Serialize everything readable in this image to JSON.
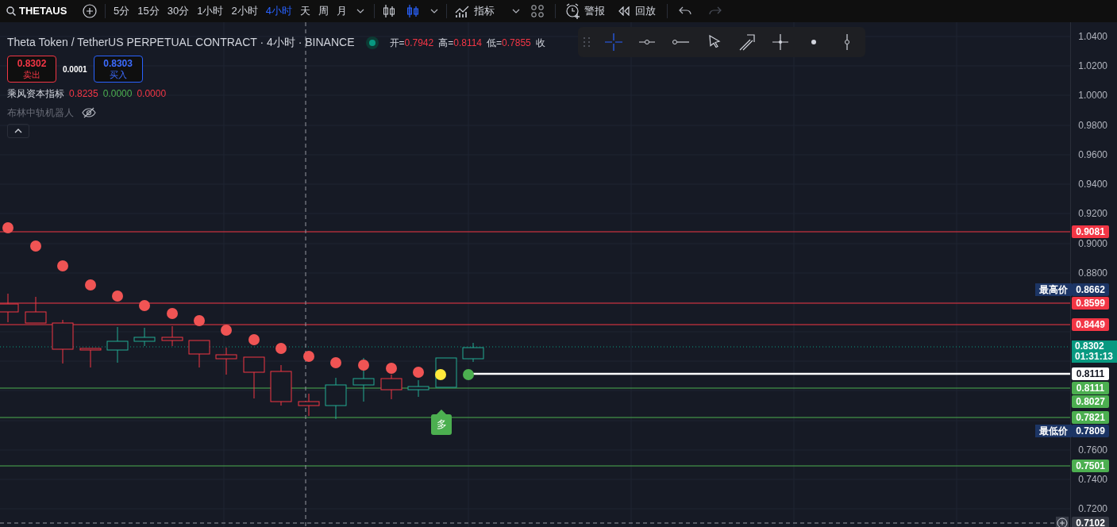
{
  "toolbar": {
    "symbol": "THETAUS",
    "intervals": [
      {
        "label": "5分",
        "selected": false
      },
      {
        "label": "15分",
        "selected": false
      },
      {
        "label": "30分",
        "selected": false
      },
      {
        "label": "1小时",
        "selected": false
      },
      {
        "label": "2小时",
        "selected": false
      },
      {
        "label": "4小时",
        "selected": true
      },
      {
        "label": "天",
        "selected": false
      },
      {
        "label": "周",
        "selected": false
      },
      {
        "label": "月",
        "selected": false
      }
    ],
    "chart_styles": [
      {
        "kind": "candles",
        "selected": false
      },
      {
        "kind": "candles",
        "selected": true
      }
    ],
    "indicators_label": "指标",
    "alert_label": "警报",
    "replay_label": "回放",
    "undo": {
      "disabled": false
    },
    "redo": {
      "disabled": true
    }
  },
  "legend": {
    "title": "Theta Token / TetherUS PERPETUAL CONTRACT · 4小时 · BINANCE",
    "ohlc": [
      {
        "label": "开=",
        "value": "0.7942"
      },
      {
        "label": "高=",
        "value": "0.8114"
      },
      {
        "label": "低=",
        "value": "0.7855"
      },
      {
        "label": "收"
      }
    ]
  },
  "trade": {
    "sell": {
      "price": "0.8302",
      "label": "卖出"
    },
    "spread": "0.0001",
    "buy": {
      "price": "0.8303",
      "label": "买入"
    }
  },
  "indicators": [
    {
      "name": "乘风资本指标",
      "hidden": false,
      "values": [
        {
          "text": "0.8235",
          "color": "#f23645"
        },
        {
          "text": "0.0000",
          "color": "#4caf50"
        },
        {
          "text": "0.0000",
          "color": "#f23645"
        }
      ]
    },
    {
      "name": "布林中轨机器人",
      "hidden": true
    }
  ],
  "drawing_tools": [
    {
      "kind": "crosshair",
      "selected": true
    },
    {
      "kind": "dot-line",
      "selected": false
    },
    {
      "kind": "ray",
      "selected": false
    },
    {
      "kind": "cursor",
      "selected": false
    },
    {
      "kind": "arrow",
      "selected": false
    },
    {
      "kind": "cross-dot",
      "selected": false
    },
    {
      "kind": "dot",
      "selected": false
    },
    {
      "kind": "vertical",
      "selected": false
    }
  ],
  "price_axis": {
    "ticks": [
      "1.0400",
      "1.0200",
      "1.0000",
      "0.9800",
      "0.9600",
      "0.9400",
      "0.9200",
      "0.9000",
      "0.8800",
      "0.7600",
      "0.7400",
      "0.7200"
    ]
  },
  "price_labels": [
    {
      "kind": "resistance",
      "text": "0.9081"
    },
    {
      "kind": "high",
      "caption": "最高价",
      "text": "0.8662"
    },
    {
      "kind": "resistance",
      "text": "0.8599"
    },
    {
      "kind": "resistance",
      "text": "0.8449"
    },
    {
      "kind": "last",
      "text": "0.8302",
      "countdown": "01:31:13"
    },
    {
      "kind": "marker",
      "text": "0.8111"
    },
    {
      "kind": "support",
      "text": "0.8111"
    },
    {
      "kind": "support",
      "text": "0.8027"
    },
    {
      "kind": "support",
      "text": "0.7821"
    },
    {
      "kind": "low",
      "caption": "最低价",
      "text": "0.7809"
    },
    {
      "kind": "support",
      "text": "0.7501"
    },
    {
      "kind": "crosshair",
      "text": "0.7102"
    }
  ],
  "signal": {
    "text": "多"
  }
}
